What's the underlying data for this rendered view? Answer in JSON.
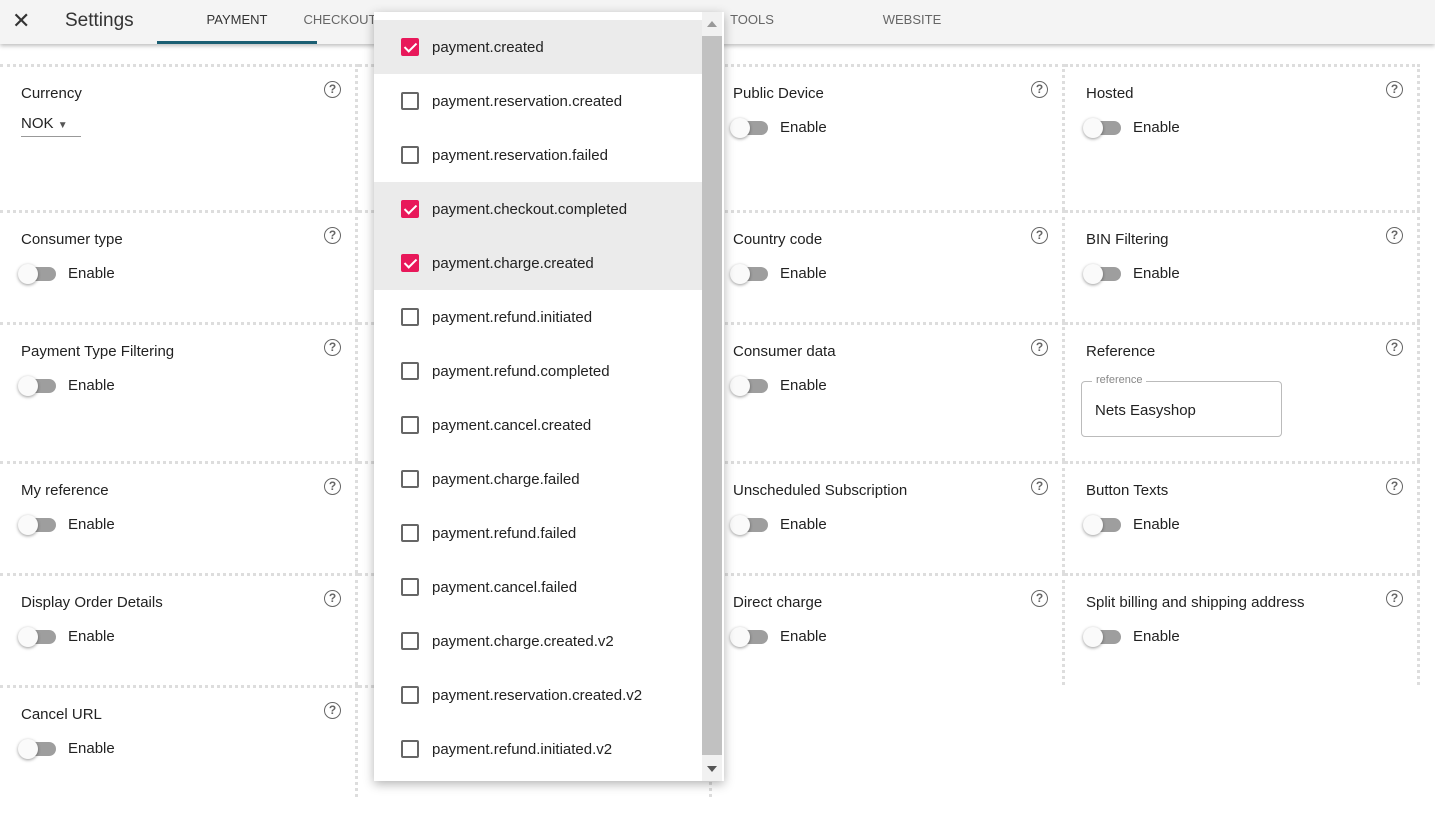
{
  "header": {
    "close_icon": "close-icon",
    "title": "Settings",
    "tabs": [
      {
        "label": "PAYMENT",
        "active": true
      },
      {
        "label": "CHECKOUT"
      },
      {
        "label": "TOOLS"
      },
      {
        "label": "WEBSITE"
      }
    ]
  },
  "accent_color": "#e8185a",
  "settings": {
    "currency": {
      "label": "Currency",
      "value": "NOK"
    },
    "consumer_type": {
      "label": "Consumer type",
      "toggle": "Enable"
    },
    "payment_type_filtering": {
      "label": "Payment Type Filtering",
      "toggle": "Enable"
    },
    "my_reference": {
      "label": "My reference",
      "toggle": "Enable"
    },
    "display_order_details": {
      "label": "Display Order Details",
      "toggle": "Enable"
    },
    "cancel_url": {
      "label": "Cancel URL",
      "toggle": "Enable"
    },
    "public_device": {
      "label": "Public Device",
      "toggle": "Enable"
    },
    "country_code": {
      "label": "Country code",
      "toggle": "Enable"
    },
    "consumer_data": {
      "label": "Consumer data",
      "toggle": "Enable"
    },
    "unscheduled_subscription": {
      "label": "Unscheduled Subscription",
      "toggle": "Enable"
    },
    "direct_charge": {
      "label": "Direct charge",
      "toggle": "Enable"
    },
    "hosted": {
      "label": "Hosted",
      "toggle": "Enable"
    },
    "bin_filtering": {
      "label": "BIN Filtering",
      "toggle": "Enable"
    },
    "reference": {
      "label": "Reference",
      "field_label": "reference",
      "value": "Nets Easyshop"
    },
    "button_texts": {
      "label": "Button Texts",
      "toggle": "Enable"
    },
    "split_address": {
      "label": "Split billing and shipping address",
      "toggle": "Enable"
    }
  },
  "dropdown": {
    "options": [
      {
        "label": "payment.created",
        "checked": true
      },
      {
        "label": "payment.reservation.created",
        "checked": false
      },
      {
        "label": "payment.reservation.failed",
        "checked": false
      },
      {
        "label": "payment.checkout.completed",
        "checked": true
      },
      {
        "label": "payment.charge.created",
        "checked": true
      },
      {
        "label": "payment.refund.initiated",
        "checked": false
      },
      {
        "label": "payment.refund.completed",
        "checked": false
      },
      {
        "label": "payment.cancel.created",
        "checked": false
      },
      {
        "label": "payment.charge.failed",
        "checked": false
      },
      {
        "label": "payment.refund.failed",
        "checked": false
      },
      {
        "label": "payment.cancel.failed",
        "checked": false
      },
      {
        "label": "payment.charge.created.v2",
        "checked": false
      },
      {
        "label": "payment.reservation.created.v2",
        "checked": false
      },
      {
        "label": "payment.refund.initiated.v2",
        "checked": false
      }
    ]
  }
}
